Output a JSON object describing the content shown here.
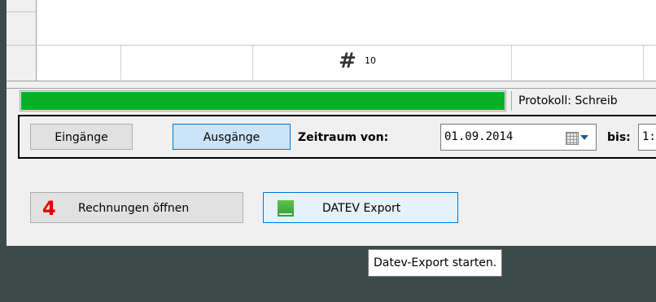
{
  "grid": {
    "hash_symbol": "#",
    "count": "10"
  },
  "status": {
    "progress": 1.0,
    "protocol_text": "Protokoll: Schreib"
  },
  "filter": {
    "incoming_label": "Eingänge",
    "outgoing_label": "Ausgänge",
    "from_label": "Zeitraum von:",
    "from_value": "01.09.2014",
    "to_label": "bis:",
    "to_value": "1:"
  },
  "actions": {
    "invoice_count": "4",
    "invoice_label": "Rechnungen öffnen",
    "datev_label": "DATEV Export"
  },
  "tooltip": {
    "text": "Datev-Export starten."
  },
  "icons": {
    "calendar": "calendar-icon",
    "dropdown": "chevron-down-icon",
    "datev": "datev-logo-icon"
  },
  "colors": {
    "progress_fill": "#06b025",
    "outgoing_active": "#cce4f7",
    "badge": "#e00000"
  }
}
